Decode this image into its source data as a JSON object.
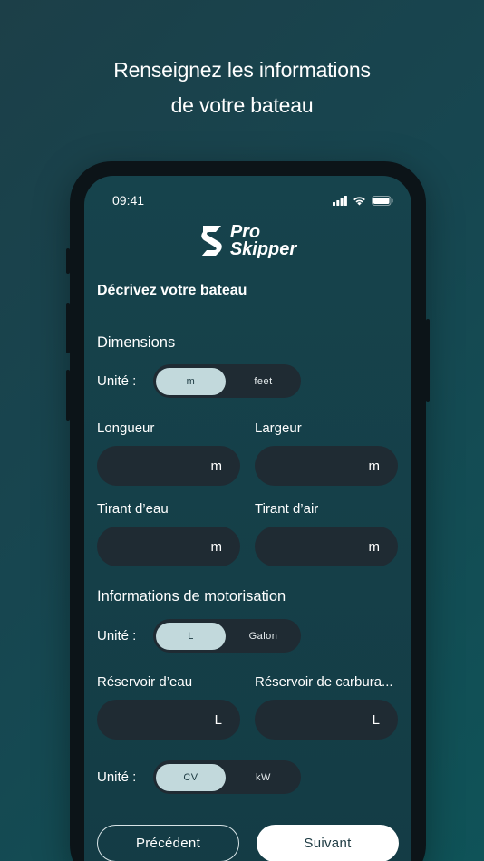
{
  "headline": {
    "line1": "Renseignez les informations",
    "line2": "de votre bateau"
  },
  "status_bar": {
    "time": "09:41",
    "icons": [
      "signal-icon",
      "wifi-icon",
      "battery-icon"
    ]
  },
  "logo": {
    "line1": "Pro",
    "line2": "Skipper",
    "icon": "pro-skipper-logo-icon"
  },
  "page_title": "Décrivez votre bateau",
  "dimensions": {
    "title": "Dimensions",
    "unit_label": "Unité :",
    "unit_options": [
      "m",
      "feet"
    ],
    "unit_selected": "m",
    "fields": [
      {
        "label": "Longueur",
        "unit": "m"
      },
      {
        "label": "Largeur",
        "unit": "m"
      },
      {
        "label": "Tirant d’eau",
        "unit": "m"
      },
      {
        "label": "Tirant d’air",
        "unit": "m"
      }
    ]
  },
  "motor": {
    "title": "Informations de motorisation",
    "unit_label": "Unité :",
    "unit_options": [
      "L",
      "Galon"
    ],
    "unit_selected": "L",
    "fields": [
      {
        "label": "Réservoir d’eau",
        "unit": "L"
      },
      {
        "label": "Réservoir de carbura...",
        "unit": "L"
      }
    ],
    "power_unit_label": "Unité :",
    "power_unit_options": [
      "CV",
      "kW"
    ],
    "power_unit_selected": "CV"
  },
  "buttons": {
    "previous": "Précédent",
    "next": "Suivant"
  },
  "colors": {
    "background": "#174650",
    "field": "#1f2b33",
    "toggle_active": "#c2d9dc",
    "text": "#ffffff"
  }
}
